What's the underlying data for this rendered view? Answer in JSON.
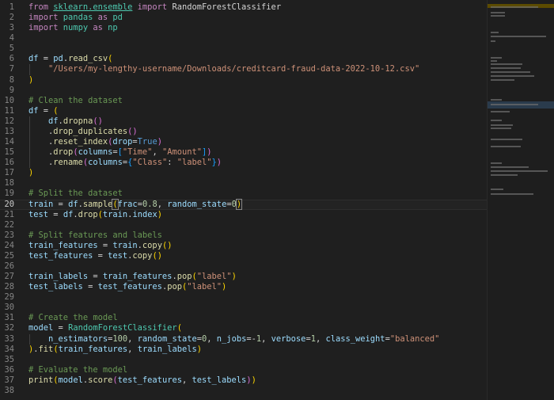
{
  "editor": {
    "current_line": 20,
    "lines": [
      {
        "n": "1",
        "t": [
          [
            "kw",
            "from "
          ],
          [
            "mod",
            "sklearn.ensemble"
          ],
          [
            "op",
            " "
          ],
          [
            "kw",
            "import"
          ],
          [
            "op",
            " RandomForestClassifier"
          ]
        ]
      },
      {
        "n": "2",
        "t": [
          [
            "kw",
            "import "
          ],
          [
            "mod",
            "pandas"
          ],
          [
            "kw",
            " as "
          ],
          [
            "mod",
            "pd"
          ]
        ]
      },
      {
        "n": "3",
        "t": [
          [
            "kw",
            "import "
          ],
          [
            "mod",
            "numpy"
          ],
          [
            "kw",
            " as "
          ],
          [
            "mod",
            "np"
          ]
        ]
      },
      {
        "n": "4",
        "t": []
      },
      {
        "n": "5",
        "t": []
      },
      {
        "n": "6",
        "t": [
          [
            "var",
            "df"
          ],
          [
            "op",
            " = "
          ],
          [
            "var",
            "pd"
          ],
          [
            "op",
            "."
          ],
          [
            "fn",
            "read_csv"
          ],
          [
            "p1",
            "("
          ]
        ]
      },
      {
        "n": "7",
        "t": [
          [
            "op",
            "    "
          ],
          [
            "str",
            "\"/Users/my-lengthy-username/Downloads/creditcard-fraud-data-2022-10-12.csv\""
          ]
        ]
      },
      {
        "n": "8",
        "t": [
          [
            "p1",
            ")"
          ]
        ]
      },
      {
        "n": "9",
        "t": []
      },
      {
        "n": "10",
        "t": [
          [
            "com",
            "# Clean the dataset"
          ]
        ]
      },
      {
        "n": "11",
        "t": [
          [
            "var",
            "df"
          ],
          [
            "op",
            " = "
          ],
          [
            "p1",
            "("
          ]
        ]
      },
      {
        "n": "12",
        "t": [
          [
            "op",
            "    "
          ],
          [
            "var",
            "df"
          ],
          [
            "op",
            "."
          ],
          [
            "fn",
            "dropna"
          ],
          [
            "p2",
            "()"
          ]
        ]
      },
      {
        "n": "13",
        "t": [
          [
            "op",
            "    ."
          ],
          [
            "fn",
            "drop_duplicates"
          ],
          [
            "p2",
            "()"
          ]
        ]
      },
      {
        "n": "14",
        "t": [
          [
            "op",
            "    ."
          ],
          [
            "fn",
            "reset_index"
          ],
          [
            "p2",
            "("
          ],
          [
            "param",
            "drop"
          ],
          [
            "op",
            "="
          ],
          [
            "const",
            "True"
          ],
          [
            "p2",
            ")"
          ]
        ]
      },
      {
        "n": "15",
        "t": [
          [
            "op",
            "    ."
          ],
          [
            "fn",
            "drop"
          ],
          [
            "p2",
            "("
          ],
          [
            "param",
            "columns"
          ],
          [
            "op",
            "="
          ],
          [
            "p3",
            "["
          ],
          [
            "str",
            "\"Time\""
          ],
          [
            "op",
            ", "
          ],
          [
            "str",
            "\"Amount\""
          ],
          [
            "p3",
            "]"
          ],
          [
            "p2",
            ")"
          ]
        ]
      },
      {
        "n": "16",
        "t": [
          [
            "op",
            "    ."
          ],
          [
            "fn",
            "rename"
          ],
          [
            "p2",
            "("
          ],
          [
            "param",
            "columns"
          ],
          [
            "op",
            "="
          ],
          [
            "p3",
            "{"
          ],
          [
            "str",
            "\"Class\""
          ],
          [
            "op",
            ": "
          ],
          [
            "str",
            "\"label\""
          ],
          [
            "p3",
            "}"
          ],
          [
            "p2",
            ")"
          ]
        ]
      },
      {
        "n": "17",
        "t": [
          [
            "p1",
            ")"
          ]
        ]
      },
      {
        "n": "18",
        "t": []
      },
      {
        "n": "19",
        "t": [
          [
            "com",
            "# Split the dataset"
          ]
        ]
      },
      {
        "n": "20",
        "t": [
          [
            "var",
            "train"
          ],
          [
            "op",
            " = "
          ],
          [
            "var",
            "df"
          ],
          [
            "op",
            "."
          ],
          [
            "fn",
            "sample"
          ],
          [
            "p1hl",
            "("
          ],
          [
            "param",
            "frac"
          ],
          [
            "op",
            "="
          ],
          [
            "num",
            "0.8"
          ],
          [
            "op",
            ", "
          ],
          [
            "param",
            "random_state"
          ],
          [
            "op",
            "="
          ],
          [
            "num",
            "0"
          ],
          [
            "p1hl",
            ")"
          ]
        ]
      },
      {
        "n": "21",
        "t": [
          [
            "var",
            "test"
          ],
          [
            "op",
            " = "
          ],
          [
            "var",
            "df"
          ],
          [
            "op",
            "."
          ],
          [
            "fn",
            "drop"
          ],
          [
            "p1",
            "("
          ],
          [
            "var",
            "train"
          ],
          [
            "op",
            "."
          ],
          [
            "var",
            "index"
          ],
          [
            "p1",
            ")"
          ]
        ]
      },
      {
        "n": "22",
        "t": []
      },
      {
        "n": "23",
        "t": [
          [
            "com",
            "# Split features and labels"
          ]
        ]
      },
      {
        "n": "24",
        "t": [
          [
            "var",
            "train_features"
          ],
          [
            "op",
            " = "
          ],
          [
            "var",
            "train"
          ],
          [
            "op",
            "."
          ],
          [
            "fn",
            "copy"
          ],
          [
            "p1",
            "()"
          ]
        ]
      },
      {
        "n": "25",
        "t": [
          [
            "var",
            "test_features"
          ],
          [
            "op",
            " = "
          ],
          [
            "var",
            "test"
          ],
          [
            "op",
            "."
          ],
          [
            "fn",
            "copy"
          ],
          [
            "p1",
            "()"
          ]
        ]
      },
      {
        "n": "26",
        "t": []
      },
      {
        "n": "27",
        "t": [
          [
            "var",
            "train_labels"
          ],
          [
            "op",
            " = "
          ],
          [
            "var",
            "train_features"
          ],
          [
            "op",
            "."
          ],
          [
            "fn",
            "pop"
          ],
          [
            "p1",
            "("
          ],
          [
            "str",
            "\"label\""
          ],
          [
            "p1",
            ")"
          ]
        ]
      },
      {
        "n": "28",
        "t": [
          [
            "var",
            "test_labels"
          ],
          [
            "op",
            " = "
          ],
          [
            "var",
            "test_features"
          ],
          [
            "op",
            "."
          ],
          [
            "fn",
            "pop"
          ],
          [
            "p1",
            "("
          ],
          [
            "str",
            "\"label\""
          ],
          [
            "p1",
            ")"
          ]
        ]
      },
      {
        "n": "29",
        "t": []
      },
      {
        "n": "30",
        "t": []
      },
      {
        "n": "31",
        "t": [
          [
            "com",
            "# Create the model"
          ]
        ]
      },
      {
        "n": "32",
        "t": [
          [
            "var",
            "model"
          ],
          [
            "op",
            " = "
          ],
          [
            "cls",
            "RandomForestClassifier"
          ],
          [
            "p1",
            "("
          ]
        ]
      },
      {
        "n": "33",
        "t": [
          [
            "op",
            "    "
          ],
          [
            "param",
            "n_estimators"
          ],
          [
            "op",
            "="
          ],
          [
            "num",
            "100"
          ],
          [
            "op",
            ", "
          ],
          [
            "param",
            "random_state"
          ],
          [
            "op",
            "="
          ],
          [
            "num",
            "0"
          ],
          [
            "op",
            ", "
          ],
          [
            "param",
            "n_jobs"
          ],
          [
            "op",
            "=-"
          ],
          [
            "num",
            "1"
          ],
          [
            "op",
            ", "
          ],
          [
            "param",
            "verbose"
          ],
          [
            "op",
            "="
          ],
          [
            "num",
            "1"
          ],
          [
            "op",
            ", "
          ],
          [
            "param",
            "class_weight"
          ],
          [
            "op",
            "="
          ],
          [
            "str",
            "\"balanced\""
          ]
        ]
      },
      {
        "n": "34",
        "t": [
          [
            "p1",
            ")"
          ],
          [
            "op",
            "."
          ],
          [
            "fn",
            "fit"
          ],
          [
            "p1",
            "("
          ],
          [
            "var",
            "train_features"
          ],
          [
            "op",
            ", "
          ],
          [
            "var",
            "train_labels"
          ],
          [
            "p1",
            ")"
          ]
        ]
      },
      {
        "n": "35",
        "t": []
      },
      {
        "n": "36",
        "t": [
          [
            "com",
            "# Evaluate the model"
          ]
        ]
      },
      {
        "n": "37",
        "t": [
          [
            "fn",
            "print"
          ],
          [
            "p1",
            "("
          ],
          [
            "var",
            "model"
          ],
          [
            "op",
            "."
          ],
          [
            "fn",
            "score"
          ],
          [
            "p2",
            "("
          ],
          [
            "var",
            "test_features"
          ],
          [
            "op",
            ", "
          ],
          [
            "var",
            "test_labels"
          ],
          [
            "p2",
            ")"
          ],
          [
            "p1",
            ")"
          ]
        ]
      },
      {
        "n": "38",
        "t": []
      }
    ]
  },
  "minimap": {
    "selection_color": "#5c4b00",
    "highlight_color": "#2a3b4c"
  }
}
